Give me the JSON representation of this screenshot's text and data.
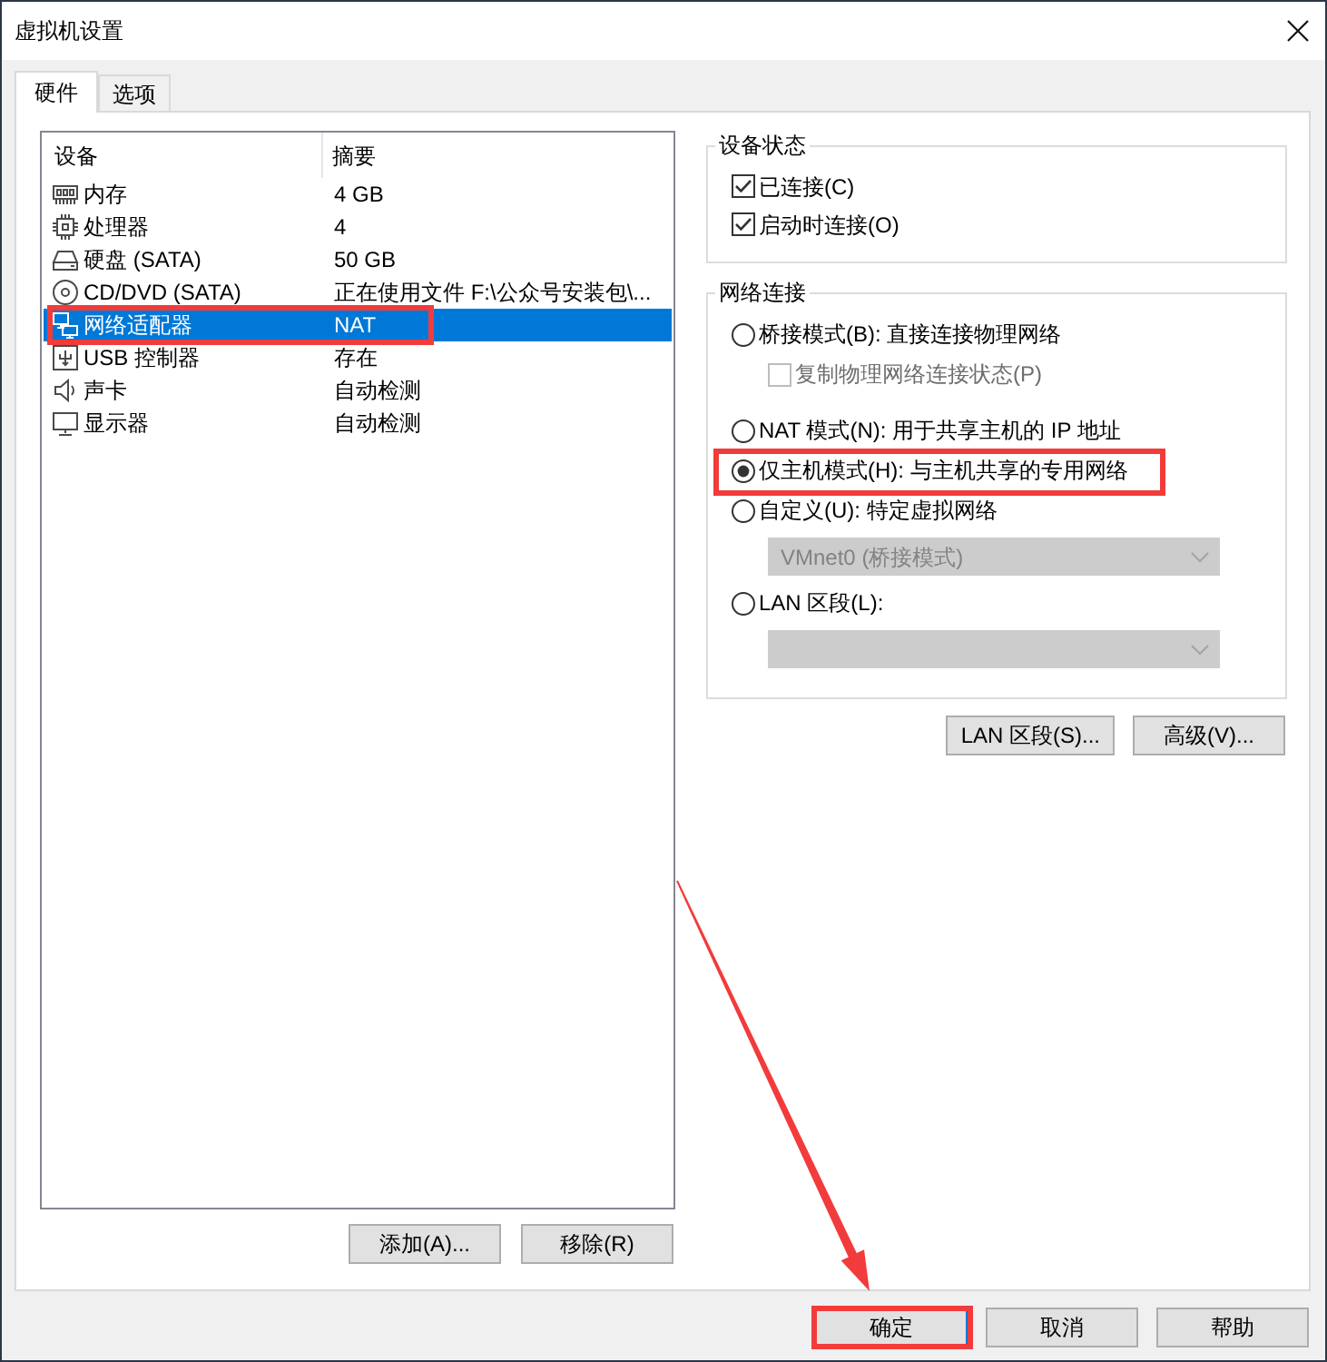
{
  "window": {
    "title": "虚拟机设置"
  },
  "tabs": [
    {
      "label": "硬件",
      "selected": true
    },
    {
      "label": "选项",
      "selected": false
    }
  ],
  "device_list": {
    "columns": [
      "设备",
      "摘要"
    ],
    "rows": [
      {
        "kind": "memory",
        "device": "内存",
        "summary": "4 GB",
        "selected": false,
        "highlighted": false
      },
      {
        "kind": "processor",
        "device": "处理器",
        "summary": "4",
        "selected": false,
        "highlighted": false
      },
      {
        "kind": "hard_disk",
        "device": "硬盘 (SATA)",
        "summary": "50 GB",
        "selected": false,
        "highlighted": false
      },
      {
        "kind": "cd_dvd",
        "device": "CD/DVD (SATA)",
        "summary": "正在使用文件 F:\\公众号安装包\\...",
        "selected": false,
        "highlighted": false
      },
      {
        "kind": "network",
        "device": "网络适配器",
        "summary": "NAT",
        "selected": true,
        "highlighted": true
      },
      {
        "kind": "usb",
        "device": "USB 控制器",
        "summary": "存在",
        "selected": false,
        "highlighted": false
      },
      {
        "kind": "sound",
        "device": "声卡",
        "summary": "自动检测",
        "selected": false,
        "highlighted": false
      },
      {
        "kind": "display",
        "device": "显示器",
        "summary": "自动检测",
        "selected": false,
        "highlighted": false
      }
    ]
  },
  "list_buttons": [
    {
      "label": "添加(A)..."
    },
    {
      "label": "移除(R)"
    }
  ],
  "device_status": {
    "title": "设备状态",
    "options": [
      {
        "label": "已连接(C)",
        "checked": true
      },
      {
        "label": "启动时连接(O)",
        "checked": true
      }
    ]
  },
  "network_connection": {
    "title": "网络连接",
    "items": [
      {
        "kind": "radio",
        "label": "桥接模式(B): 直接连接物理网络",
        "selected": false,
        "disabled": false,
        "highlighted": false
      },
      {
        "kind": "checkbox",
        "label": "复制物理网络连接状态(P)",
        "checked": false,
        "disabled": true,
        "highlighted": false
      },
      {
        "kind": "radio",
        "label": "NAT 模式(N): 用于共享主机的 IP 地址",
        "selected": false,
        "disabled": false,
        "highlighted": false
      },
      {
        "kind": "radio",
        "label": "仅主机模式(H): 与主机共享的专用网络",
        "selected": true,
        "disabled": false,
        "highlighted": true
      },
      {
        "kind": "radio",
        "label": "自定义(U): 特定虚拟网络",
        "selected": false,
        "disabled": false,
        "highlighted": false
      },
      {
        "kind": "select",
        "value": "VMnet0 (桥接模式)",
        "disabled": true,
        "highlighted": false
      },
      {
        "kind": "radio",
        "label": "LAN 区段(L):",
        "selected": false,
        "disabled": false,
        "highlighted": false
      },
      {
        "kind": "select",
        "disabled": true,
        "highlighted": false
      }
    ]
  },
  "network_buttons": [
    {
      "label": "LAN 区段(S)..."
    },
    {
      "label": "高级(V)..."
    }
  ],
  "dialog_buttons": [
    {
      "label": "确定",
      "default": true,
      "highlighted": true,
      "arrow": true
    },
    {
      "label": "取消",
      "default": false,
      "highlighted": false,
      "arrow": false
    },
    {
      "label": "帮助",
      "default": false,
      "highlighted": false,
      "arrow": false
    }
  ]
}
